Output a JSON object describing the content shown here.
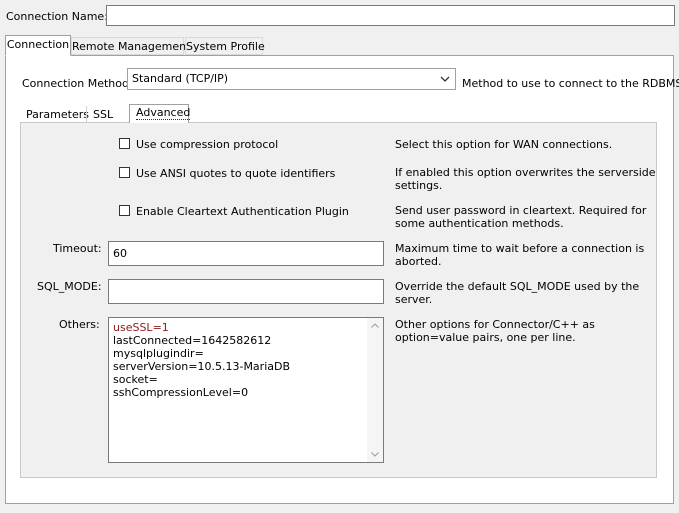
{
  "connection_name": {
    "label": "Connection Name:",
    "value": ""
  },
  "main_tabs": [
    {
      "label": "Connection",
      "active": true
    },
    {
      "label": "Remote Management",
      "active": false
    },
    {
      "label": "System Profile",
      "active": false
    }
  ],
  "connection_method": {
    "label": "Connection Method:",
    "value": "Standard (TCP/IP)",
    "description": "Method to use to connect to the RDBMS"
  },
  "sub_tabs": [
    {
      "label": "Parameters",
      "active": false
    },
    {
      "label": "SSL",
      "active": false
    },
    {
      "label": "Advanced",
      "active": true
    }
  ],
  "options": {
    "compression": {
      "label": "Use compression protocol",
      "checked": false,
      "description": [
        "Select this option for WAN connections."
      ]
    },
    "ansi_quotes": {
      "label": "Use ANSI quotes to quote identifiers",
      "checked": false,
      "description": [
        "If enabled this option overwrites the serverside",
        "settings."
      ]
    },
    "cleartext": {
      "label": "Enable Cleartext Authentication Plugin",
      "checked": false,
      "description": [
        "Send user password in cleartext. Required for",
        "some authentication methods."
      ]
    }
  },
  "timeout": {
    "label": "Timeout:",
    "value": "60",
    "description": [
      "Maximum time to wait before a connection is",
      "aborted."
    ]
  },
  "sql_mode": {
    "label": "SQL_MODE:",
    "value": "",
    "description": [
      "Override the default SQL_MODE used by the",
      "server."
    ]
  },
  "others": {
    "label": "Others:",
    "lines": [
      "useSSL=1",
      "lastConnected=1642582612",
      "mysqlplugindir=",
      "serverVersion=10.5.13-MariaDB",
      "socket=",
      "sshCompressionLevel=0"
    ],
    "description": [
      "Other options for Connector/C++ as",
      "option=value pairs, one per line."
    ]
  },
  "colors": {
    "highlight_line": "#8b1a1a",
    "border": "#a0a0a0"
  },
  "icons": {
    "dropdown": "chevron-down-icon",
    "scroll_up": "scroll-up-arrow-icon",
    "scroll_down": "scroll-down-arrow-icon"
  }
}
